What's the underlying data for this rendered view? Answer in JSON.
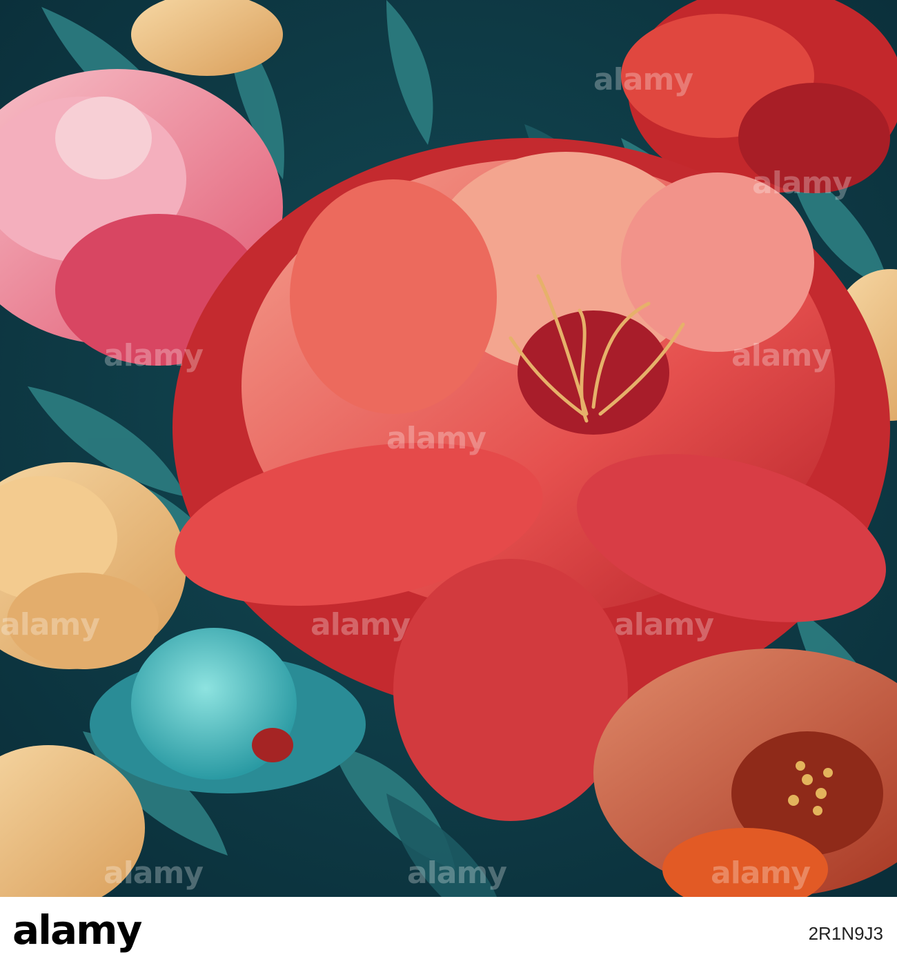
{
  "watermark_text": "alamy",
  "footer": {
    "logo": "alamy",
    "caption": "",
    "image_id": "2R1N9J3"
  },
  "colors": {
    "background": "#0f3b45",
    "flower_coral": "#e85a57",
    "flower_red": "#c8282b",
    "flower_pink": "#f19cb0",
    "flower_peach": "#f1c38a",
    "bud_teal": "#4fcad0",
    "leaf_teal": "#2b7a7e"
  }
}
